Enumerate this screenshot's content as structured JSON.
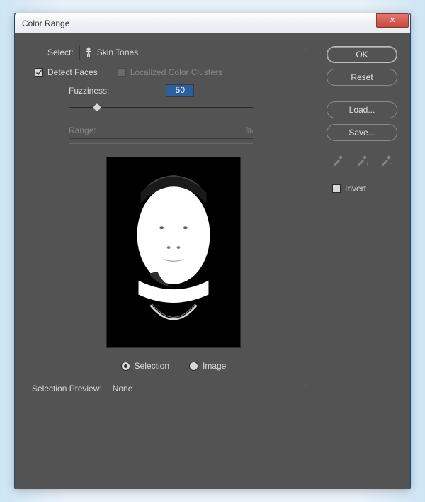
{
  "window": {
    "title": "Color Range"
  },
  "select": {
    "label": "Select:",
    "value": "Skin Tones"
  },
  "detect_faces": {
    "label": "Detect Faces",
    "checked": true
  },
  "localized": {
    "label": "Localized Color Clusters",
    "enabled": false
  },
  "fuzziness": {
    "label": "Fuzziness:",
    "value": "50"
  },
  "range": {
    "label": "Range:",
    "unit": "%"
  },
  "preview_mode": {
    "selection": "Selection",
    "image": "Image",
    "active": "selection"
  },
  "selection_preview": {
    "label": "Selection Preview:",
    "value": "None"
  },
  "buttons": {
    "ok": "OK",
    "reset": "Reset",
    "load": "Load...",
    "save": "Save..."
  },
  "invert": {
    "label": "Invert",
    "checked": false
  },
  "icons": {
    "eyedropper": "eyedropper-icon",
    "eyedropper_add": "eyedropper-add-icon",
    "eyedropper_sub": "eyedropper-sub-icon",
    "close": "close-icon",
    "caret": "chevron-down-icon",
    "skin": "person-icon"
  }
}
